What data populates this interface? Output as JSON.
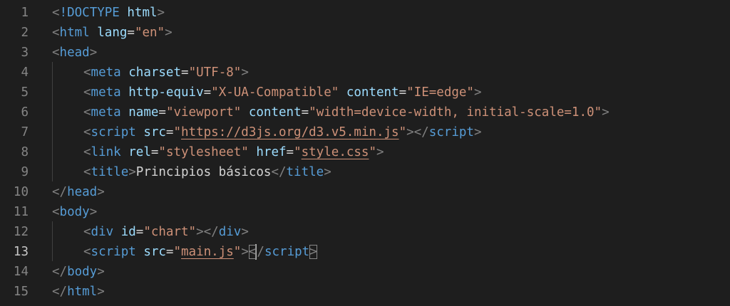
{
  "editor": {
    "active_line": 13,
    "lines": [
      {
        "num": "1",
        "tokens": [
          [
            "punct",
            "<"
          ],
          [
            "tag",
            "!DOCTYPE"
          ],
          [
            "text",
            " "
          ],
          [
            "attr",
            "html"
          ],
          [
            "punct",
            ">"
          ]
        ]
      },
      {
        "num": "2",
        "tokens": [
          [
            "punct",
            "<"
          ],
          [
            "tag",
            "html"
          ],
          [
            "text",
            " "
          ],
          [
            "attr",
            "lang"
          ],
          [
            "text",
            "="
          ],
          [
            "str",
            "\"en\""
          ],
          [
            "punct",
            ">"
          ]
        ]
      },
      {
        "num": "3",
        "tokens": [
          [
            "punct",
            "<"
          ],
          [
            "tag",
            "head"
          ],
          [
            "punct",
            ">"
          ]
        ]
      },
      {
        "num": "4",
        "indent": true,
        "tokens": [
          [
            "punct",
            "<"
          ],
          [
            "tag",
            "meta"
          ],
          [
            "text",
            " "
          ],
          [
            "attr",
            "charset"
          ],
          [
            "text",
            "="
          ],
          [
            "str",
            "\"UTF-8\""
          ],
          [
            "punct",
            ">"
          ]
        ]
      },
      {
        "num": "5",
        "indent": true,
        "tokens": [
          [
            "punct",
            "<"
          ],
          [
            "tag",
            "meta"
          ],
          [
            "text",
            " "
          ],
          [
            "attr",
            "http-equiv"
          ],
          [
            "text",
            "="
          ],
          [
            "str",
            "\"X-UA-Compatible\""
          ],
          [
            "text",
            " "
          ],
          [
            "attr",
            "content"
          ],
          [
            "text",
            "="
          ],
          [
            "str",
            "\"IE=edge\""
          ],
          [
            "punct",
            ">"
          ]
        ]
      },
      {
        "num": "6",
        "indent": true,
        "tokens": [
          [
            "punct",
            "<"
          ],
          [
            "tag",
            "meta"
          ],
          [
            "text",
            " "
          ],
          [
            "attr",
            "name"
          ],
          [
            "text",
            "="
          ],
          [
            "str",
            "\"viewport\""
          ],
          [
            "text",
            " "
          ],
          [
            "attr",
            "content"
          ],
          [
            "text",
            "="
          ],
          [
            "str",
            "\"width=device-width, initial-scale=1.0\""
          ],
          [
            "punct",
            ">"
          ]
        ]
      },
      {
        "num": "7",
        "indent": true,
        "tokens": [
          [
            "punct",
            "<"
          ],
          [
            "tag",
            "script"
          ],
          [
            "text",
            " "
          ],
          [
            "attr",
            "src"
          ],
          [
            "text",
            "="
          ],
          [
            "str",
            "\""
          ],
          [
            "link",
            "https://d3js.org/d3.v5.min.js"
          ],
          [
            "str",
            "\""
          ],
          [
            "punct",
            "></"
          ],
          [
            "tag",
            "script"
          ],
          [
            "punct",
            ">"
          ]
        ]
      },
      {
        "num": "8",
        "indent": true,
        "tokens": [
          [
            "punct",
            "<"
          ],
          [
            "tag",
            "link"
          ],
          [
            "text",
            " "
          ],
          [
            "attr",
            "rel"
          ],
          [
            "text",
            "="
          ],
          [
            "str",
            "\"stylesheet\""
          ],
          [
            "text",
            " "
          ],
          [
            "attr",
            "href"
          ],
          [
            "text",
            "="
          ],
          [
            "str",
            "\""
          ],
          [
            "link",
            "style.css"
          ],
          [
            "str",
            "\""
          ],
          [
            "punct",
            ">"
          ]
        ]
      },
      {
        "num": "9",
        "indent": true,
        "tokens": [
          [
            "punct",
            "<"
          ],
          [
            "tag",
            "title"
          ],
          [
            "punct",
            ">"
          ],
          [
            "text",
            "Principios básicos"
          ],
          [
            "punct",
            "</"
          ],
          [
            "tag",
            "title"
          ],
          [
            "punct",
            ">"
          ]
        ]
      },
      {
        "num": "10",
        "tokens": [
          [
            "punct",
            "</"
          ],
          [
            "tag",
            "head"
          ],
          [
            "punct",
            ">"
          ]
        ]
      },
      {
        "num": "11",
        "tokens": [
          [
            "punct",
            "<"
          ],
          [
            "tag",
            "body"
          ],
          [
            "punct",
            ">"
          ]
        ]
      },
      {
        "num": "12",
        "indent": true,
        "tokens": [
          [
            "punct",
            "<"
          ],
          [
            "tag",
            "div"
          ],
          [
            "text",
            " "
          ],
          [
            "attr",
            "id"
          ],
          [
            "text",
            "="
          ],
          [
            "str",
            "\"chart\""
          ],
          [
            "punct",
            "></"
          ],
          [
            "tag",
            "div"
          ],
          [
            "punct",
            ">"
          ]
        ]
      },
      {
        "num": "13",
        "indent": true,
        "tokens": [
          [
            "punct",
            "<"
          ],
          [
            "tag",
            "script"
          ],
          [
            "text",
            " "
          ],
          [
            "attr",
            "src"
          ],
          [
            "text",
            "="
          ],
          [
            "str",
            "\""
          ],
          [
            "link",
            "main.js"
          ],
          [
            "str",
            "\""
          ],
          [
            "punct",
            ">"
          ],
          [
            "match",
            "<"
          ],
          [
            "cursor",
            ""
          ],
          [
            "punct",
            "/"
          ],
          [
            "tag",
            "script"
          ],
          [
            "match",
            ">"
          ]
        ]
      },
      {
        "num": "14",
        "tokens": [
          [
            "punct",
            "</"
          ],
          [
            "tag",
            "body"
          ],
          [
            "punct",
            ">"
          ]
        ]
      },
      {
        "num": "15",
        "tokens": [
          [
            "punct",
            "</"
          ],
          [
            "tag",
            "html"
          ],
          [
            "punct",
            ">"
          ]
        ]
      }
    ]
  },
  "colors": {
    "background": "#1e1e1e",
    "tag": "#569cd6",
    "attribute": "#9cdcfe",
    "string": "#ce9178",
    "punctuation": "#808080",
    "text": "#d4d4d4",
    "line_number": "#858585"
  }
}
